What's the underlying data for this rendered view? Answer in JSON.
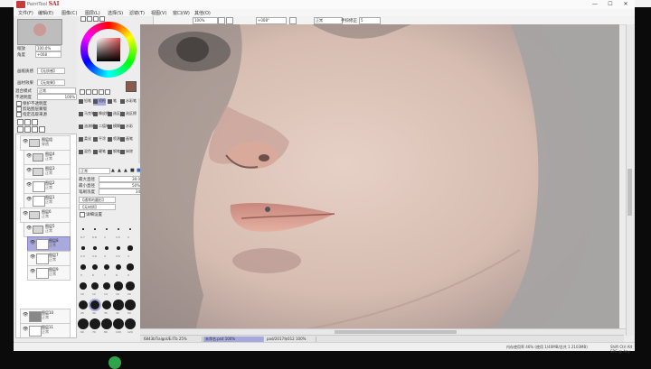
{
  "app": {
    "title_prefix": "PaintTool",
    "title_name": "SAI"
  },
  "window_controls": {
    "minimize": "—",
    "restore": "☐",
    "close": "✕"
  },
  "menu": [
    "文件(F)",
    "编辑(E)",
    "图像(C)",
    "图层(L)",
    "选择(S)",
    "滤镜(T)",
    "视图(V)",
    "窗口(W)",
    "其他(O)"
  ],
  "toolbar": {
    "zoom": "100%",
    "angle": "+008°",
    "blend": "正常",
    "stab_label": "手抖修正",
    "stab_value": "5"
  },
  "navigator": {
    "zoom_label": "缩放",
    "zoom_value": "100.0%",
    "angle_label": "角度",
    "angle_value": "+008"
  },
  "left": {
    "mode_a_label": "画纸质感",
    "mode_a_value": "【无质感】",
    "mode_b_label": "画材效果",
    "mode_b_value": "【无效果】",
    "blend_label": "混合模式",
    "blend_value": "正常",
    "opacity_label": "不透明度",
    "opacity_value": "100%",
    "options": [
      "保护不透明度",
      "剪贴图层蒙版",
      "指定选取来源"
    ]
  },
  "layers": [
    {
      "name": "图层组",
      "mode": "穿透",
      "type": "folder"
    },
    {
      "name": "图层4",
      "mode": "正常",
      "type": "folder"
    },
    {
      "name": "图层3",
      "mode": "正常",
      "type": "folder"
    },
    {
      "name": "图层2",
      "mode": "正常",
      "type": "layer"
    },
    {
      "name": "图层1",
      "mode": "正常",
      "type": "layer"
    },
    {
      "name": "图层6",
      "mode": "正常",
      "type": "folder"
    },
    {
      "name": "图层5",
      "mode": "正常",
      "type": "folder"
    },
    {
      "name": "图层8",
      "mode": "正常",
      "type": "layer",
      "selected": true
    },
    {
      "name": "图层7",
      "mode": "正常",
      "type": "layer"
    },
    {
      "name": "图层9",
      "mode": "正常",
      "type": "layer"
    },
    {
      "name": "图层10",
      "mode": "正常",
      "type": "layer"
    },
    {
      "name": "图层11",
      "mode": "正常",
      "type": "layer"
    }
  ],
  "tools": [
    [
      "铅笔",
      "喷枪",
      "笔",
      "水彩笔"
    ],
    [
      "马克笔",
      "橡皮擦",
      "选区笔",
      "选区擦"
    ],
    [
      "油漆桶",
      "二值笔",
      "模糊",
      "水彩"
    ],
    [
      "柔化",
      "平涂",
      "喷溅",
      "画笔"
    ],
    [
      "混色",
      "硬笔",
      "钢笔",
      "抹除"
    ]
  ],
  "brush": {
    "blend_value": "正常",
    "max_size_label": "最大直径",
    "max_size_value": "30.0",
    "min_size_label": "最小直径",
    "min_size_value": "50%",
    "density_label": "笔刷浓度",
    "density_value": "34",
    "shape_value": "【通常的圆形】",
    "texture_value": "【无材质】",
    "detail_label": "详细设置"
  },
  "brush_sizes": [
    "0.7",
    "0.8",
    "1",
    "1.5",
    "2",
    "2.3",
    "2.6",
    "3",
    "3.5",
    "4",
    "5",
    "6",
    "7",
    "8",
    "9",
    "10",
    "12",
    "14",
    "16",
    "20",
    "25",
    "30",
    "35",
    "40",
    "50",
    "60",
    "70",
    "80",
    "100",
    "120"
  ],
  "doc_tabs": [
    {
      "label": "6843bTiaigoUE.lTb",
      "zoom": "25%"
    },
    {
      "label": "未命名.psd",
      "zoom": "100%",
      "active": true
    },
    {
      "label": "pad/2017年012",
      "zoom": "100%"
    }
  ],
  "status": {
    "memory": "内存使用率 46% (使用 1/40MB/总共 1 2103MB)",
    "keys": "Shift Ctrl Alt SPC @ Any"
  },
  "colors": {
    "accent": "#a9a9de",
    "skin": "#d9b6a8",
    "lips": "#d79d8f",
    "bg": "#c9c3bd"
  }
}
